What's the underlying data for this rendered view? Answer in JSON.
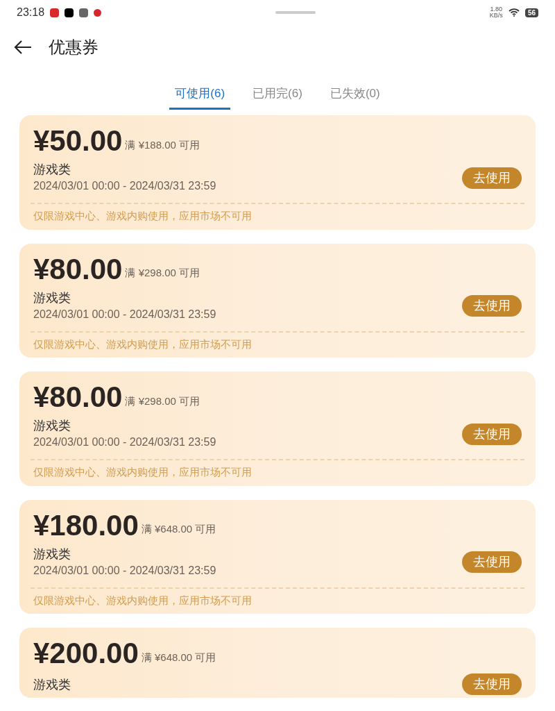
{
  "status_bar": {
    "time": "23:18",
    "network_speed": "1.80",
    "network_unit": "KB/s",
    "battery": "56"
  },
  "header": {
    "title": "优惠券"
  },
  "tabs": [
    {
      "label": "可使用(6)",
      "selected": true
    },
    {
      "label": "已用完(6)",
      "selected": false
    },
    {
      "label": "已失效(0)",
      "selected": false
    }
  ],
  "coupons": [
    {
      "amount": "¥50.00",
      "threshold": "满 ¥188.00 可用",
      "category": "游戏类",
      "validity": "2024/03/01 00:00 - 2024/03/31 23:59",
      "button": "去使用",
      "note": "仅限游戏中心、游戏内购使用，应用市场不可用"
    },
    {
      "amount": "¥80.00",
      "threshold": "满 ¥298.00 可用",
      "category": "游戏类",
      "validity": "2024/03/01 00:00 - 2024/03/31 23:59",
      "button": "去使用",
      "note": "仅限游戏中心、游戏内购使用，应用市场不可用"
    },
    {
      "amount": "¥80.00",
      "threshold": "满 ¥298.00 可用",
      "category": "游戏类",
      "validity": "2024/03/01 00:00 - 2024/03/31 23:59",
      "button": "去使用",
      "note": "仅限游戏中心、游戏内购使用，应用市场不可用"
    },
    {
      "amount": "¥180.00",
      "threshold": "满 ¥648.00 可用",
      "category": "游戏类",
      "validity": "2024/03/01 00:00 - 2024/03/31 23:59",
      "button": "去使用",
      "note": "仅限游戏中心、游戏内购使用，应用市场不可用"
    },
    {
      "amount": "¥200.00",
      "threshold": "满 ¥648.00 可用",
      "category": "游戏类",
      "button": "去使用"
    }
  ]
}
